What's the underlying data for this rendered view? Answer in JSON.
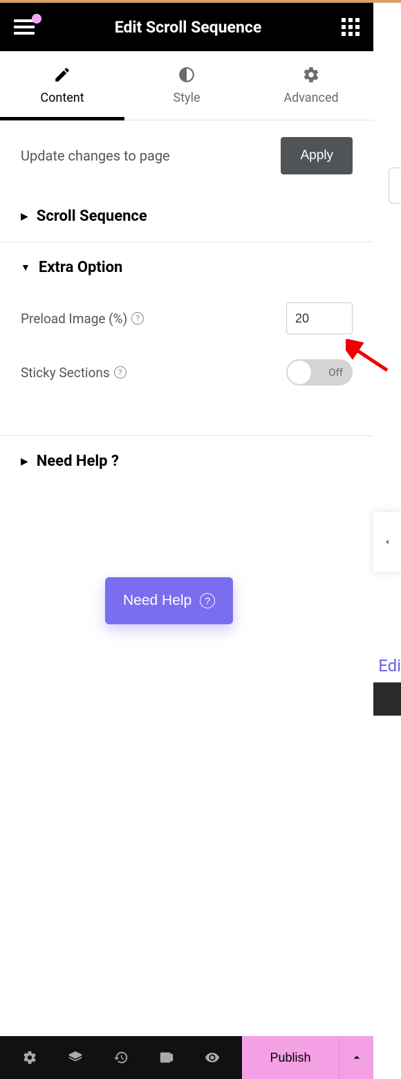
{
  "header": {
    "title": "Edit Scroll Sequence"
  },
  "tabs": {
    "content": "Content",
    "style": "Style",
    "advanced": "Advanced"
  },
  "update": {
    "text": "Update changes to page",
    "button": "Apply"
  },
  "sections": {
    "scroll_sequence": "Scroll Sequence",
    "extra_option": "Extra Option",
    "need_help": "Need Help ?"
  },
  "fields": {
    "preload_label": "Preload Image (%)",
    "preload_value": "20",
    "sticky_label": "Sticky Sections",
    "toggle_off": "Off"
  },
  "help_button": "Need Help",
  "bottom": {
    "publish": "Publish"
  },
  "side": {
    "edi": "Edi"
  }
}
